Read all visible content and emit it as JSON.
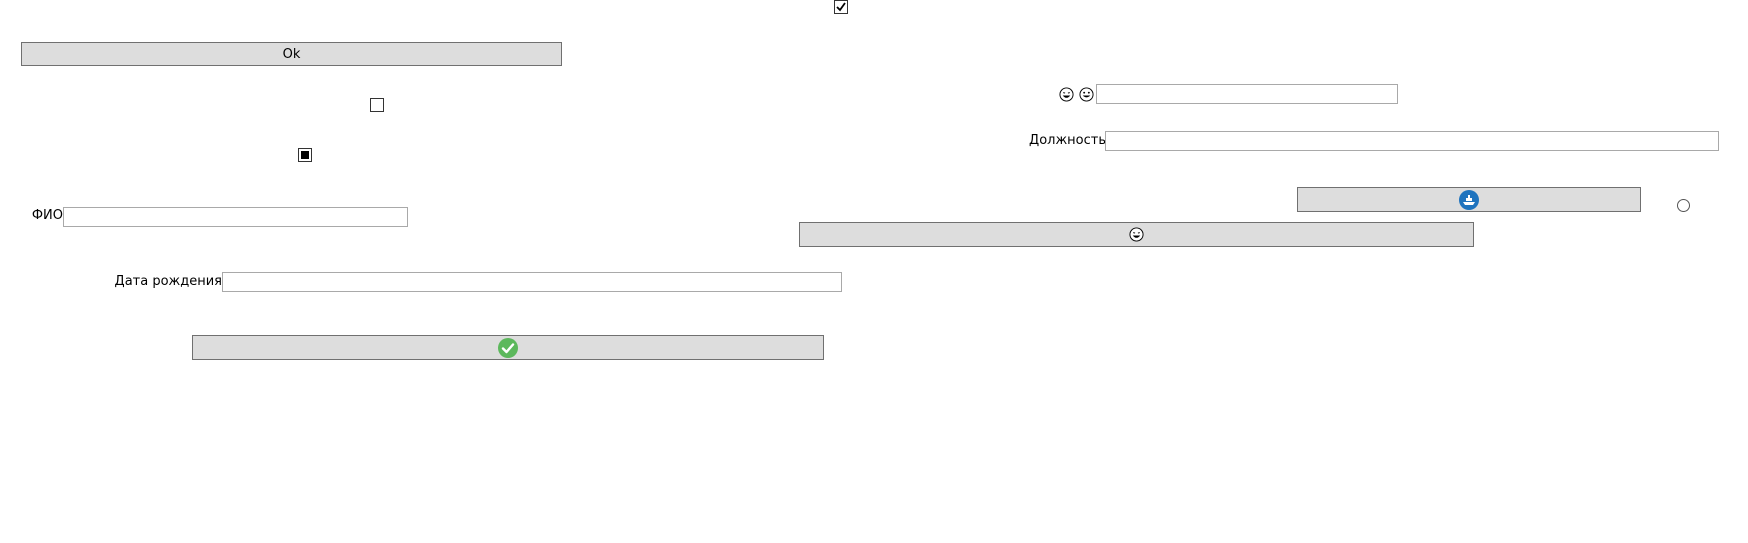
{
  "buttons": {
    "ok_label": "Ok",
    "confirm_icon": "check-circle-green-icon",
    "ship_icon": "ship-blue-circle-icon",
    "laugh_icon": "laughing-face-icon"
  },
  "labels": {
    "fio": "ФИО",
    "birth_date": "Дата рождения",
    "position": "Должность"
  },
  "inputs": {
    "fio_value": "",
    "birth_date_value": "",
    "position_value": "",
    "emoji_field_value": ""
  },
  "checkboxes": {
    "top_checked": true,
    "middle_checked": false,
    "indeterminate_state": "indeterminate"
  },
  "radio": {
    "selected": false
  },
  "icons": {
    "emoji_laugh": "laughing-face-icon",
    "emoji_grin": "grinning-face-icon"
  },
  "colors": {
    "button_bg": "#dddddd",
    "confirm_green": "#5cb85c",
    "ship_blue": "#1e73be"
  }
}
